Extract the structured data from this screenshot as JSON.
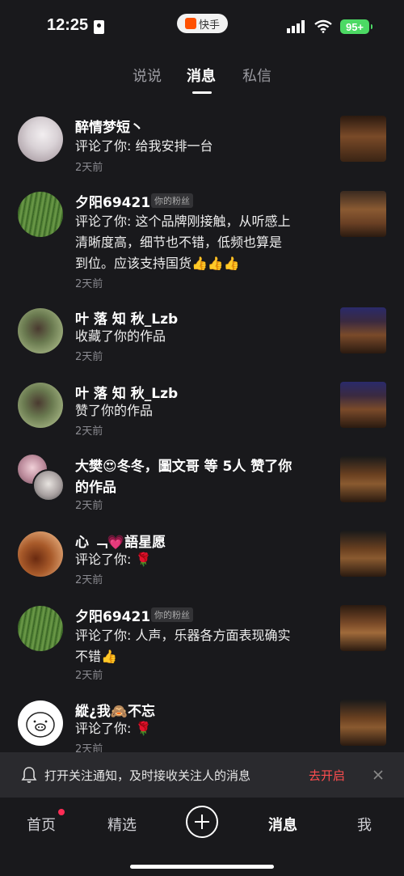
{
  "status_bar": {
    "time": "12:25",
    "app_name": "快手",
    "battery": "95+",
    "icons": [
      "id-card-icon",
      "signal-icon",
      "wifi-icon",
      "battery-icon"
    ]
  },
  "tabs": [
    {
      "label": "说说",
      "active": false
    },
    {
      "label": "消息",
      "active": true
    },
    {
      "label": "私信",
      "active": false
    }
  ],
  "messages": [
    {
      "name": "醉情梦短丶",
      "badge": "",
      "content": "评论了你: 给我安排一台",
      "time": "2天前"
    },
    {
      "name": "夕阳69421",
      "badge": "你的粉丝",
      "content_lines": [
        "评论了你: 这个品牌刚接触，从听感上",
        "清晰度高，细节也不错，低频也算是",
        "到位。应该支持国货👍👍👍"
      ],
      "time": "2天前"
    },
    {
      "name": "叶 落 知 秋_Lzb",
      "badge": "",
      "content": "收藏了你的作品",
      "time": "2天前"
    },
    {
      "name": "叶 落 知 秋_Lzb",
      "badge": "",
      "content": "赞了你的作品",
      "time": "2天前"
    },
    {
      "name_lines": [
        "大樊😍冬冬，圖文哥 等 5人 赞了你",
        "的作品"
      ],
      "badge": "",
      "time": "2天前"
    },
    {
      "name": "心 ﹁💗語星愿",
      "badge": "",
      "content": "评论了你: 🌹",
      "time": "2天前"
    },
    {
      "name": "夕阳69421",
      "badge": "你的粉丝",
      "content_lines": [
        "评论了你: 人声，乐器各方面表现确实",
        "不错👍"
      ],
      "time": "2天前"
    },
    {
      "name": "縱¿我🙈不忘",
      "badge": "",
      "content": "评论了你: 🌹",
      "time": "2天前"
    }
  ],
  "notice": {
    "text": "打开关注通知，及时接收关注人的消息",
    "action": "去开启"
  },
  "bottom_nav": [
    {
      "label": "首页",
      "has_dot": true
    },
    {
      "label": "精选"
    },
    {
      "label": "消息",
      "active": true
    },
    {
      "label": "我"
    }
  ],
  "colors": {
    "background": "#19191c",
    "accent_red": "#ff4d4f",
    "battery_green": "#4cd964"
  }
}
